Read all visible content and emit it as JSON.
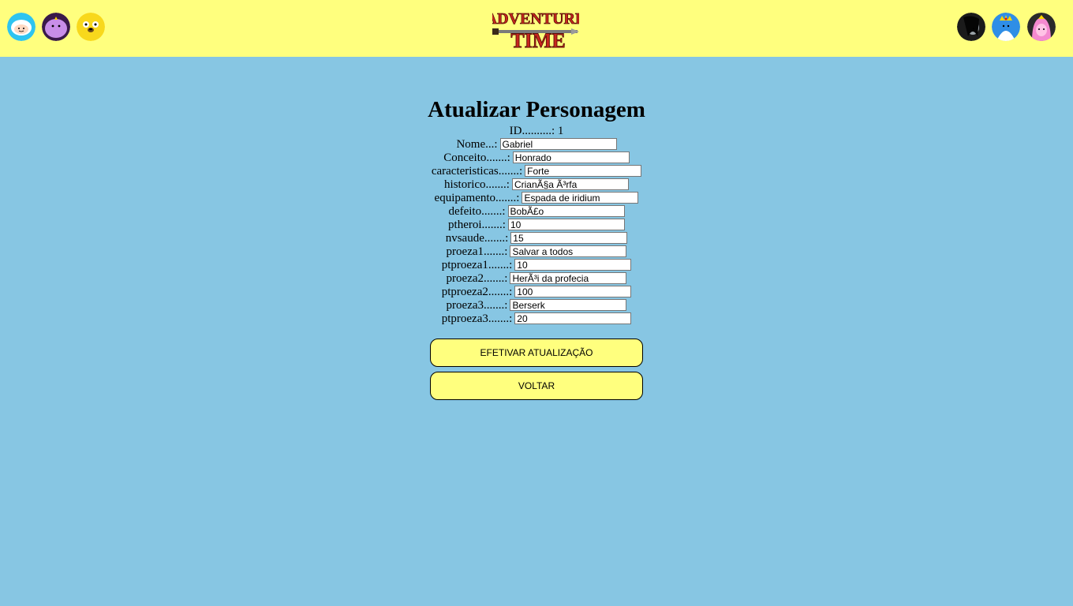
{
  "header": {
    "logo_text": "Adventure Time",
    "left_avatars": [
      "finn-avatar",
      "lumpy-space-princess-avatar",
      "jake-avatar"
    ],
    "right_avatars": [
      "marceline-avatar",
      "ice-king-avatar",
      "princess-bubblegum-avatar"
    ]
  },
  "form": {
    "title": "Atualizar Personagem",
    "id_label": "ID..........: 1",
    "fields": [
      {
        "label": "Nome...:",
        "value": "Gabriel"
      },
      {
        "label": "Conceito.......:",
        "value": "Honrado"
      },
      {
        "label": "caracteristicas.......:",
        "value": "Forte"
      },
      {
        "label": "historico.......:",
        "value": "CrianÃ§a Ã³rfa"
      },
      {
        "label": "equipamento.......:",
        "value": "Espada de iridium"
      },
      {
        "label": "defeito.......:",
        "value": "BobÃ£o"
      },
      {
        "label": "ptheroi.......:",
        "value": "10"
      },
      {
        "label": "nvsaude.......:",
        "value": "15"
      },
      {
        "label": "proeza1.......:",
        "value": "Salvar a todos"
      },
      {
        "label": "ptproeza1.......:",
        "value": "10"
      },
      {
        "label": "proeza2.......:",
        "value": "HerÃ³i da profecia"
      },
      {
        "label": "ptproeza2.......:",
        "value": "100"
      },
      {
        "label": "proeza3.......:",
        "value": "Berserk"
      },
      {
        "label": "ptproeza3.......:",
        "value": "20"
      }
    ],
    "submit_label": "EFETIVAR ATUALIZAÇÃO",
    "back_label": "VOLTAR"
  },
  "colors": {
    "header_bg": "#ffff7e",
    "page_bg": "#87c6e3",
    "button_bg": "#ffff7e"
  }
}
